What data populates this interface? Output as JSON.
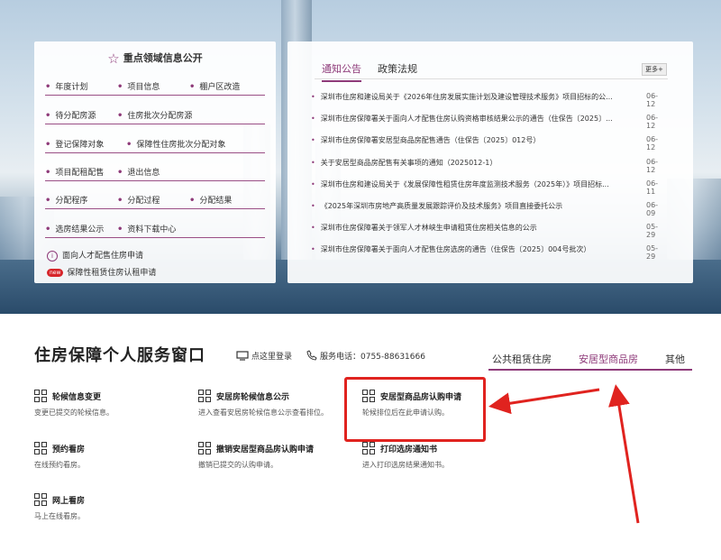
{
  "featured_panel": {
    "title": "重点领域信息公开",
    "rows": [
      [
        "年度计划",
        "项目信息",
        "棚户区改造"
      ],
      [
        "待分配房源",
        "住房批次分配房源"
      ],
      [
        "登记保障对象",
        "保障性住房批次分配对象"
      ],
      [
        "项目配租配售",
        "退出信息"
      ],
      [
        "分配程序",
        "分配过程",
        "分配结果"
      ],
      [
        "选房结果公示",
        "资料下载中心"
      ]
    ],
    "link1": "面向人才配售住房申请",
    "link2_badge": "new",
    "link2": "保障性租赁住房认租申请"
  },
  "news_panel": {
    "tabs": [
      "通知公告",
      "政策法规"
    ],
    "more": "更多+",
    "items": [
      {
        "title": "深圳市住房和建设局关于《2026年住房发展实施计划及建设管理技术服务》项目招标的公...",
        "date": "06-12"
      },
      {
        "title": "深圳市住房保障署关于面向人才配售住房认购资格审核结果公示的通告（住保告〔2025〕...",
        "date": "06-12"
      },
      {
        "title": "深圳市住房保障署安居型商品房配售通告（住保告〔2025〕012号）",
        "date": "06-12"
      },
      {
        "title": "关于安居型商品房配售有关事项的通知（2025012-1）",
        "date": "06-12"
      },
      {
        "title": "深圳市住房和建设局关于《发展保障性租赁住房年度监测技术服务（2025年）》项目招标...",
        "date": "06-11"
      },
      {
        "title": "《2025年深圳市房地产高质量发展跟踪评价及技术服务》项目直接委托公示",
        "date": "06-09"
      },
      {
        "title": "深圳市住房保障署关于领军人才林峡生申请租赁住房相关信息的公示",
        "date": "05-29"
      },
      {
        "title": "深圳市住房保障署关于面向人才配售住房选房的通告（住保告〔2025〕004号批次）",
        "date": "05-29"
      }
    ]
  },
  "service": {
    "title": "住房保障个人服务窗口",
    "login": "点这里登录",
    "phone": "服务电话：0755-88631666",
    "tabs": [
      "公共租赁住房",
      "安居型商品房",
      "其他"
    ],
    "items": [
      {
        "name": "轮候信息变更",
        "desc": "变更已提交的轮候信息。"
      },
      {
        "name": "安居房轮候信息公示",
        "desc": "进入查看安居房轮候信息公示查看排位。"
      },
      {
        "name": "安居型商品房认购申请",
        "desc": "轮候排位后在此申请认购。"
      },
      {
        "name": "预约看房",
        "desc": "在线预约看房。"
      },
      {
        "name": "撤销安居型商品房认购申请",
        "desc": "撤销已提交的认购申请。"
      },
      {
        "name": "打印选房通知书",
        "desc": "进入打印选房结果通知书。"
      },
      {
        "name": "网上看房",
        "desc": "马上在线看房。"
      }
    ]
  },
  "colors": {
    "accent": "#8e3a79",
    "highlight": "#e0231f"
  }
}
